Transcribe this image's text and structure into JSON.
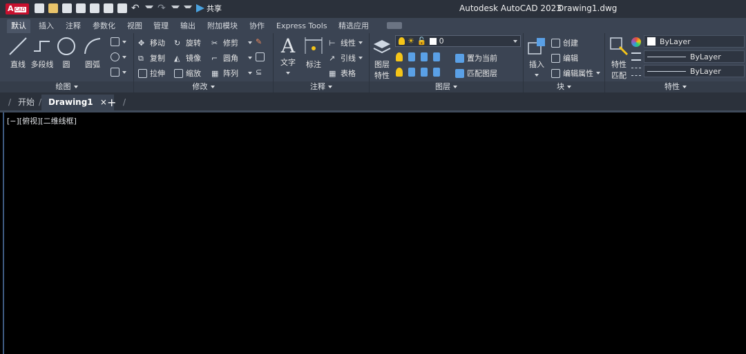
{
  "app": {
    "logo_a": "A",
    "logo_sub": "CAD",
    "title": "Autodesk AutoCAD 2023",
    "document": "Drawing1.dwg",
    "share_label": "共享"
  },
  "qat_icons": [
    "new-file-icon",
    "open-folder-icon",
    "save-icon",
    "save-as-icon",
    "web-mobile-icon",
    "publish-icon",
    "print-icon",
    "undo-icon",
    "redo-icon",
    "customize-dropdown-icon"
  ],
  "ribbon_tabs": [
    "默认",
    "插入",
    "注释",
    "参数化",
    "视图",
    "管理",
    "输出",
    "附加模块",
    "协作",
    "Express Tools",
    "精选应用"
  ],
  "panels": {
    "draw": {
      "label": "绘图",
      "line": "直线",
      "polyline": "多段线",
      "circle": "圆",
      "arc": "圆弧"
    },
    "modify": {
      "label": "修改",
      "move": "移动",
      "rotate": "旋转",
      "trim": "修剪",
      "copy": "复制",
      "mirror": "镜像",
      "fillet": "圆角",
      "stretch": "拉伸",
      "scale": "缩放",
      "array": "阵列"
    },
    "annotation": {
      "label": "注释",
      "text": "文字",
      "dimension": "标注",
      "linear": "线性",
      "leader": "引线",
      "table": "表格"
    },
    "layers": {
      "label": "图层",
      "properties_1": "图层",
      "properties_2": "特性",
      "current_layer": "0",
      "set_current": "置为当前",
      "match_layer": "匹配图层"
    },
    "block": {
      "label": "块",
      "insert": "插入",
      "create": "创建",
      "edit": "编辑",
      "edit_attributes": "编辑属性"
    },
    "properties": {
      "label": "特性",
      "match_1": "特性",
      "match_2": "匹配",
      "color": "ByLayer",
      "linetype": "ByLayer",
      "lineweight": "ByLayer"
    }
  },
  "doc_tabs": {
    "start": "开始",
    "drawing": "Drawing1",
    "close": "×",
    "add": "+"
  },
  "viewport": {
    "label": "[−][俯视][二维线框]"
  },
  "colors": {
    "title_bg": "#2b313b",
    "ribbon_bg": "#3b4453",
    "canvas": "#000000",
    "logo_red": "#c8102e",
    "bulb_yellow": "#f5c518"
  }
}
